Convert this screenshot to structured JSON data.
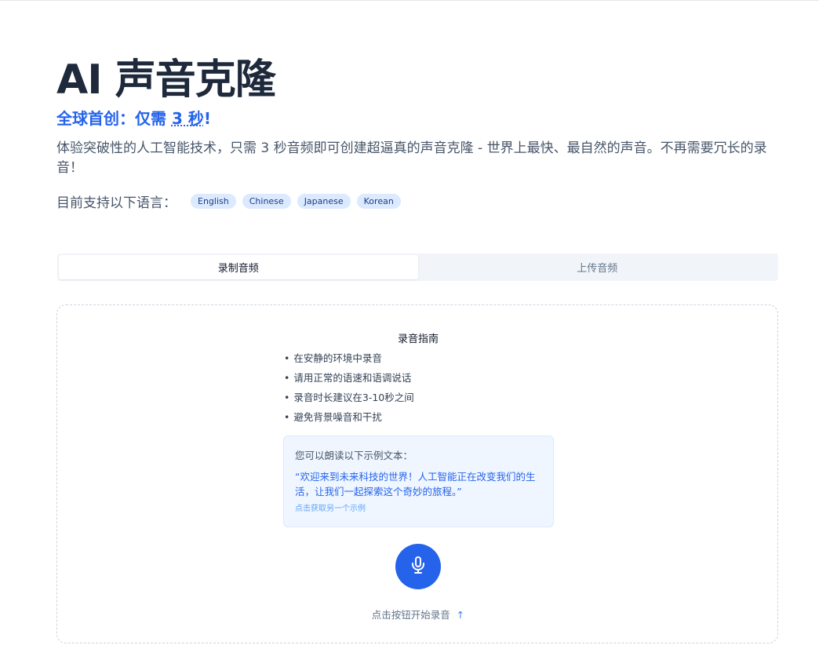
{
  "header": {
    "title": "AI 声音克隆",
    "subtitle_prefix": "全球首创：仅需 ",
    "subtitle_highlight": "3 秒",
    "subtitle_suffix": "!",
    "description": "体验突破性的人工智能技术，只需 3 秒音频即可创建超逼真的声音克隆 - 世界上最快、最自然的声音。不再需要冗长的录音！",
    "languages_label": "目前支持以下语言：",
    "languages": [
      "English",
      "Chinese",
      "Japanese",
      "Korean"
    ]
  },
  "tabs": [
    {
      "label": "录制音频",
      "active": true
    },
    {
      "label": "上传音频",
      "active": false
    }
  ],
  "guide": {
    "title": "录音指南",
    "items": [
      "在安静的环境中录音",
      "请用正常的语速和语调说话",
      "录音时长建议在3-10秒之间",
      "避免背景噪音和干扰"
    ]
  },
  "sample": {
    "heading": "您可以朗读以下示例文本：",
    "text": "“欢迎来到未来科技的世界！人工智能正在改变我们的生活，让我们一起探索这个奇妙的旅程。”",
    "another_link": "点击获取另一个示例"
  },
  "record": {
    "icon": "microphone-icon",
    "hint": "点击按钮开始录音",
    "hint_arrow": "↑"
  },
  "colors": {
    "accent": "#2563eb",
    "title": "#1e293b"
  }
}
